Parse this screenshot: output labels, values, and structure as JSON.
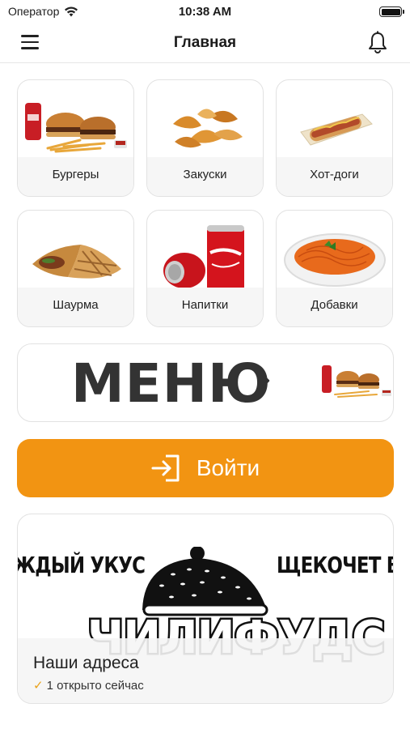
{
  "status_bar": {
    "carrier": "Оператор",
    "time": "10:38 AM"
  },
  "header": {
    "title": "Главная"
  },
  "categories": [
    {
      "label": "Бургеры",
      "image": "burgers-image"
    },
    {
      "label": "Закуски",
      "image": "potato-wedges-image"
    },
    {
      "label": "Хот-доги",
      "image": "hotdog-image"
    },
    {
      "label": "Шаурма",
      "image": "shawarma-image"
    },
    {
      "label": "Напитки",
      "image": "cola-cans-image"
    },
    {
      "label": "Добавки",
      "image": "carrot-salad-image"
    }
  ],
  "menu_banner": {
    "title": "МЕНЮ"
  },
  "login": {
    "label": "Войти",
    "icon": "login-icon"
  },
  "addresses": {
    "ticker_left": "ЖДЫЙ УКУС",
    "ticker_right": "ЩЕКОЧЕТ ВК",
    "brand": "ЧИЛИФУДС",
    "title": "Наши адреса",
    "status": "1 открыто сейчас"
  },
  "colors": {
    "accent": "#f29412",
    "check": "#e9a21a"
  }
}
